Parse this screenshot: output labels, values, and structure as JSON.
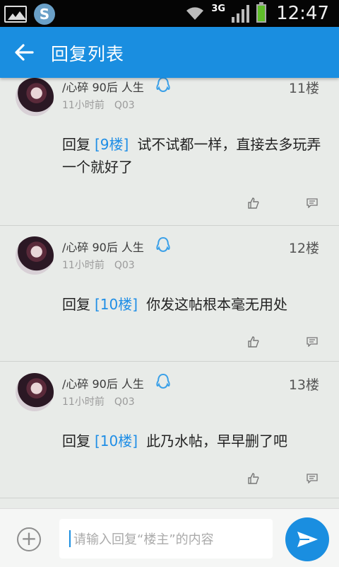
{
  "status": {
    "time": "12:47",
    "network": "3G"
  },
  "appbar": {
    "title": "回复列表"
  },
  "posts": [
    {
      "user": "/心碎 90后 人生",
      "time": "11小时前",
      "client": "Q03",
      "floor": "11楼",
      "reply_prefix": "回复",
      "reply_ref": "[9楼]",
      "text": "试不试都一样，直接去多玩弄一个就好了"
    },
    {
      "user": "/心碎 90后 人生",
      "time": "11小时前",
      "client": "Q03",
      "floor": "12楼",
      "reply_prefix": "回复",
      "reply_ref": "[10楼]",
      "text": "你发这帖根本毫无用处"
    },
    {
      "user": "/心碎 90后 人生",
      "time": "11小时前",
      "client": "Q03",
      "floor": "13楼",
      "reply_prefix": "回复",
      "reply_ref": "[10楼]",
      "text": "此乃水帖，早早删了吧"
    }
  ],
  "composer": {
    "placeholder": "请输入回复“楼主”的内容"
  }
}
